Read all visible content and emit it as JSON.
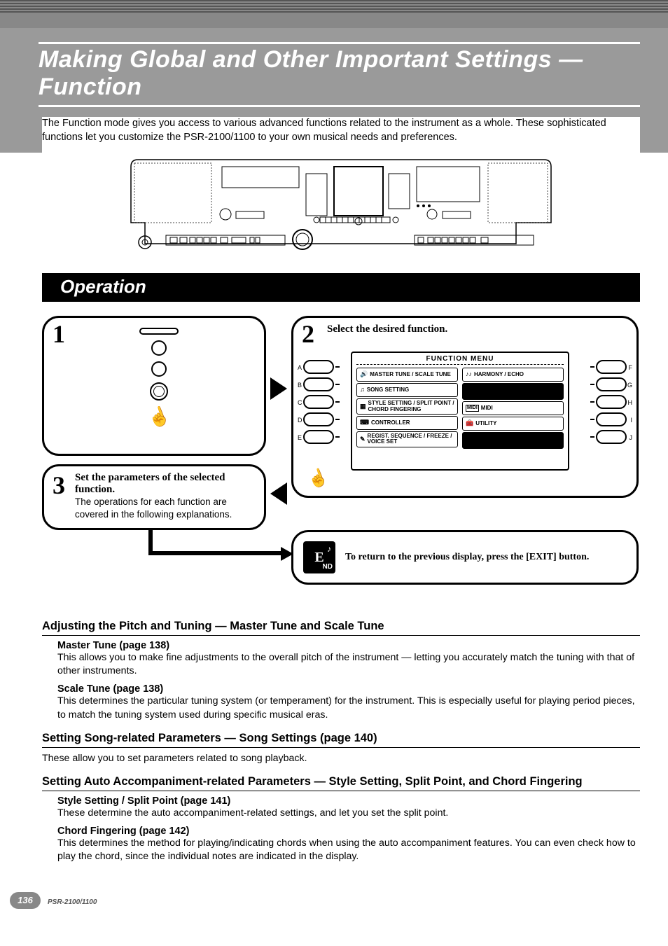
{
  "page_title": "Making Global and Other Important Settings — Function",
  "intro": "The Function mode gives you access to various advanced functions related to the instrument as a whole. These sophisticated functions let you customize the PSR-2100/1100 to your own musical needs and preferences.",
  "operation_heading": "Operation",
  "steps": {
    "s1": "1",
    "s2": "2",
    "s2_title": "Select the desired function.",
    "s3": "3",
    "s3_title": "Set the parameters of the selected function.",
    "s3_body": "The operations for each function are covered in the following explanations.",
    "end_text": "To return to the previous display, press the [EXIT] button.",
    "end_icon_main": "E",
    "end_icon_sub": "ND"
  },
  "screen": {
    "title": "FUNCTION MENU",
    "left_letters": [
      "A",
      "B",
      "C",
      "D",
      "E"
    ],
    "right_letters": [
      "F",
      "G",
      "H",
      "I",
      "J"
    ],
    "col1": [
      "MASTER TUNE / SCALE TUNE",
      "SONG SETTING",
      "STYLE SETTING / SPLIT POINT / CHORD FINGERING",
      "CONTROLLER",
      "REGIST. SEQUENCE / FREEZE / VOICE SET"
    ],
    "col2": [
      "HARMONY / ECHO",
      "",
      "MIDI",
      "UTILITY",
      ""
    ]
  },
  "sections": {
    "pitch_h": "Adjusting the Pitch and Tuning — Master Tune and Scale Tune",
    "master_h": "Master Tune (page 138)",
    "master_b": "This allows you to make fine adjustments to the overall pitch of the instrument — letting you accurately match the tuning with that of other instruments.",
    "scale_h": "Scale Tune (page 138)",
    "scale_b": "This determines the particular tuning system (or temperament) for the instrument. This is especially useful for playing period pieces, to match the tuning system used during specific musical eras.",
    "song_h": "Setting Song-related Parameters — Song Settings (page 140)",
    "song_b": "These allow you to set parameters related to song playback.",
    "accomp_h": "Setting Auto Accompaniment-related Parameters — Style Setting, Split Point, and Chord Fingering",
    "style_h": "Style Setting / Split Point (page 141)",
    "style_b": "These determine the auto accompaniment-related settings, and let you set the split point.",
    "chord_h": "Chord Fingering (page 142)",
    "chord_b": "This determines the method for playing/indicating chords when using the auto accompaniment features. You can even check how to play the chord, since the individual notes are indicated in the display."
  },
  "footer": {
    "page_number": "136",
    "model": "PSR-2100/1100"
  }
}
